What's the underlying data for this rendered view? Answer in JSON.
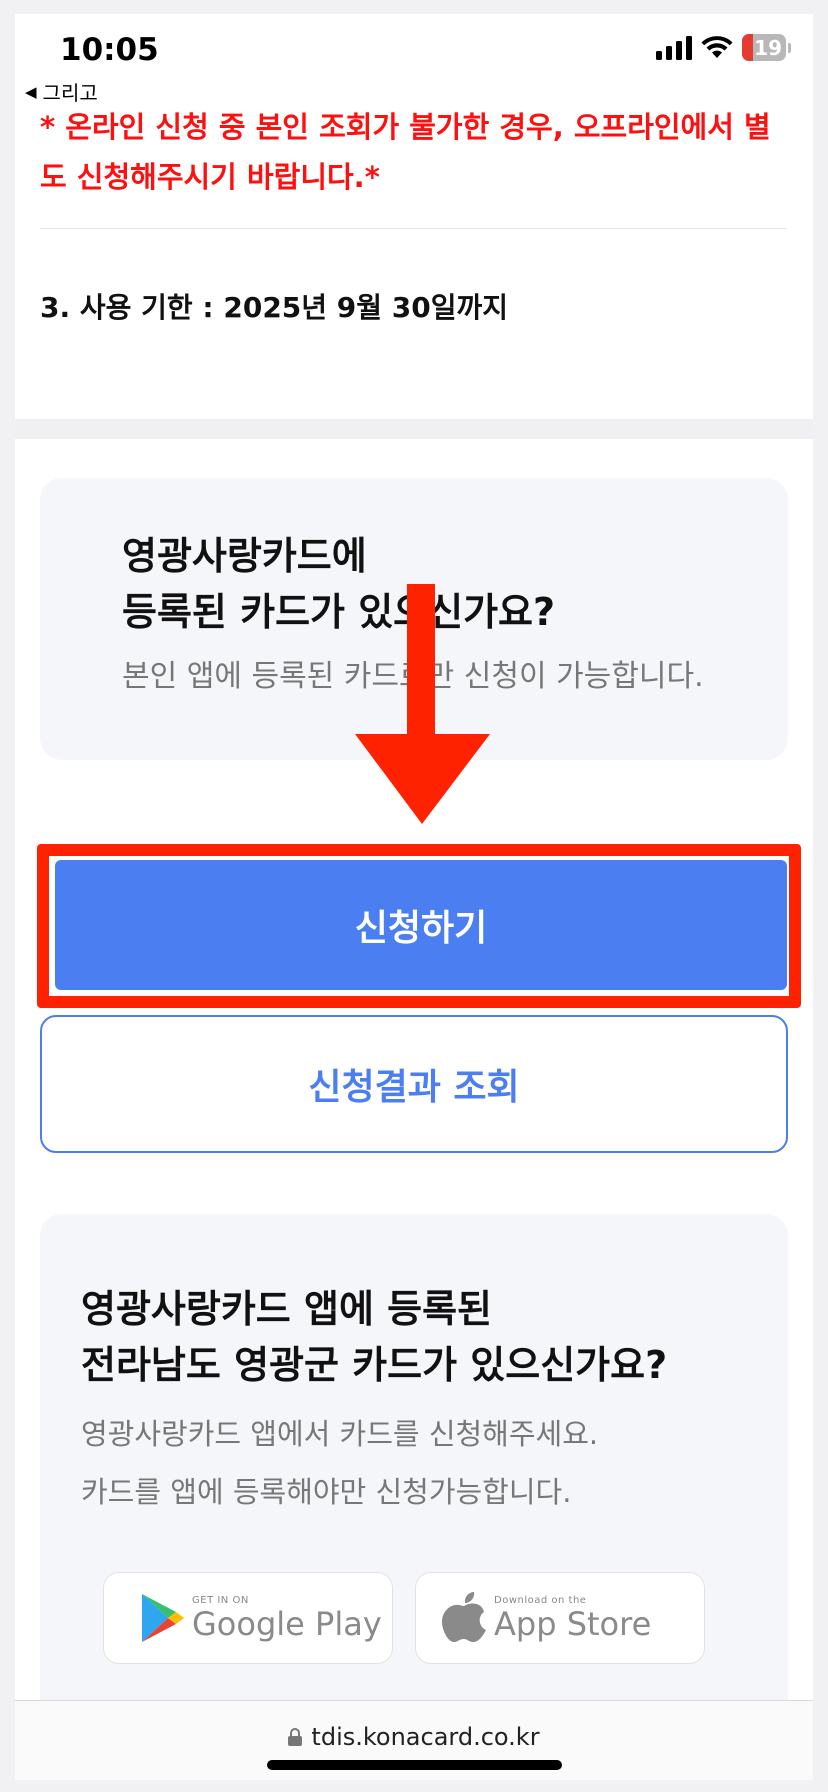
{
  "status_bar": {
    "time": "10:05",
    "battery_level": "19",
    "back_label": "그리고"
  },
  "notice": {
    "red_text": "* 온라인 신청 중 본인 조회가 불가한 경우, 오프라인에서 별도 신청해주시기 바랍니다.*",
    "usage_term": "3. 사용 기한 : 2025년 9월 30일까지"
  },
  "card1": {
    "title": "영광사랑카드에\n등록된 카드가 있으신가요?",
    "subtitle": "본인 앱에 등록된 카드로만 신청이 가능합니다."
  },
  "buttons": {
    "apply": "신청하기",
    "lookup": "신청결과 조회"
  },
  "card2": {
    "title": "영광사랑카드 앱에 등록된\n전라남도 영광군 카드가 있으신가요?",
    "line1": "영광사랑카드 앱에서 카드를 신청해주세요.",
    "line2": "카드를 앱에 등록해야만 신청가능합니다."
  },
  "stores": {
    "google_small": "GET IN ON",
    "google_big": "Google Play",
    "apple_small": "Download on the",
    "apple_big": "App Store"
  },
  "url_bar": {
    "url": "tdis.konacard.co.kr"
  },
  "colors": {
    "accent": "#4b7ef0",
    "annotation": "#ff2200",
    "notice_red": "#ff1010"
  }
}
